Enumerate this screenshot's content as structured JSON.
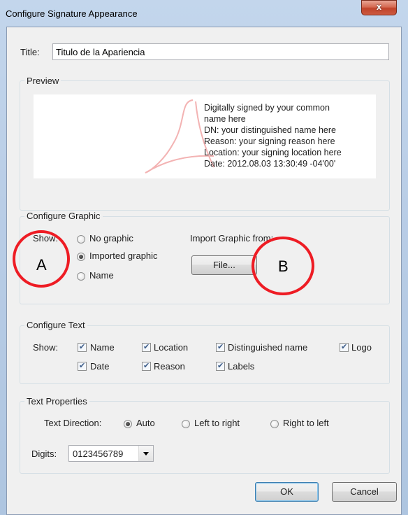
{
  "window": {
    "title": "Configure Signature Appearance",
    "close_glyph": "x"
  },
  "title_field": {
    "label": "Title:",
    "value": "Titulo de la Apariencia"
  },
  "preview": {
    "group_label": "Preview",
    "lines": [
      "Digitally signed by your common",
      "name here",
      "DN: your distinguished name here",
      "Reason: your signing reason here",
      "Location: your signing location here",
      "Date: 2012.08.03 13:30:49 -04'00'"
    ]
  },
  "configure_graphic": {
    "group_label": "Configure Graphic",
    "show_label": "Show:",
    "options": [
      {
        "label": "No graphic",
        "selected": false
      },
      {
        "label": "Imported graphic",
        "selected": true
      },
      {
        "label": "Name",
        "selected": false
      }
    ],
    "import_label": "Import Graphic from:",
    "file_button": "File..."
  },
  "configure_text": {
    "group_label": "Configure Text",
    "show_label": "Show:",
    "checkboxes": [
      {
        "label": "Name",
        "checked": true
      },
      {
        "label": "Location",
        "checked": true
      },
      {
        "label": "Distinguished name",
        "checked": true
      },
      {
        "label": "Logo",
        "checked": true
      },
      {
        "label": "Date",
        "checked": true
      },
      {
        "label": "Reason",
        "checked": true
      },
      {
        "label": "Labels",
        "checked": true
      }
    ]
  },
  "text_properties": {
    "group_label": "Text Properties",
    "direction_label": "Text Direction:",
    "direction_options": [
      {
        "label": "Auto",
        "selected": true
      },
      {
        "label": "Left to right",
        "selected": false
      },
      {
        "label": "Right to left",
        "selected": false
      }
    ],
    "digits_label": "Digits:",
    "digits_value": "0123456789"
  },
  "buttons": {
    "ok": "OK",
    "cancel": "Cancel"
  },
  "annotations": {
    "a": "A",
    "b": "B",
    "color": "#ee1c24"
  }
}
